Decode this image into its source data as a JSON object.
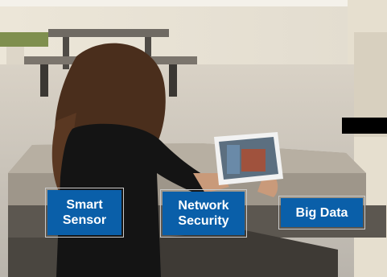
{
  "badges": {
    "smart_sensor": {
      "line1": "Smart",
      "line2": "Sensor"
    },
    "network_security": {
      "line1": "Network",
      "line2": "Security"
    },
    "big_data": {
      "label": "Big Data"
    }
  },
  "colors": {
    "badge_background": "#0a5fa9",
    "badge_text": "#ffffff"
  }
}
